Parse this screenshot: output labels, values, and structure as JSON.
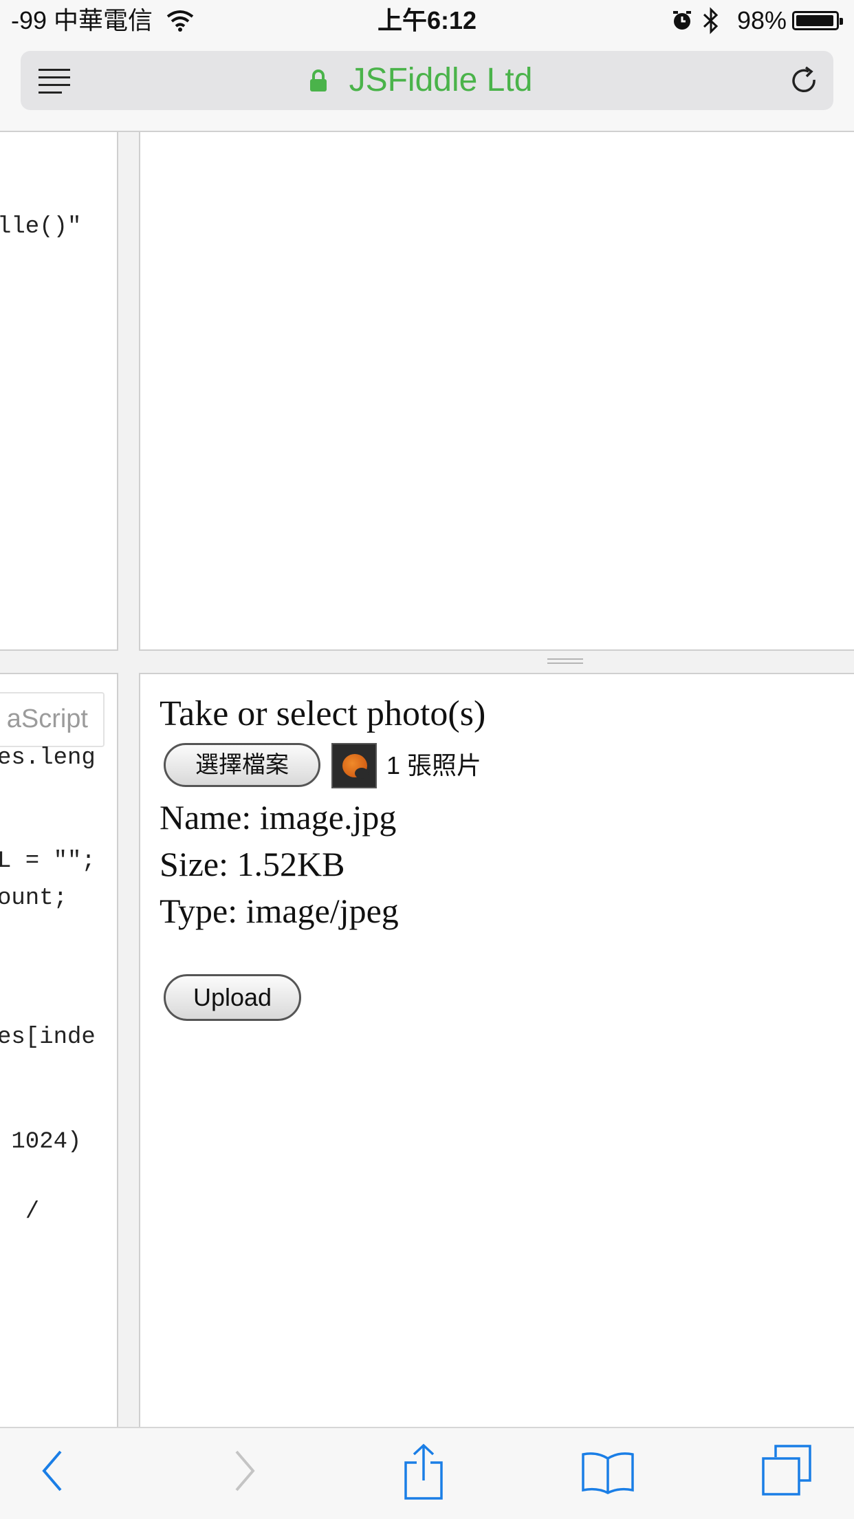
{
  "status_bar": {
    "carrier": "-99 中華電信",
    "time": "上午6:12",
    "battery": "98%"
  },
  "address_bar": {
    "site_name": "JSFiddle Ltd"
  },
  "code_fragments": {
    "html_line": "lle()\"",
    "lang_label": "aScript",
    "js_lines": [
      "es.leng",
      "L = \"\";",
      "ount;",
      "es[inde",
      " 1024)",
      "  /"
    ]
  },
  "result": {
    "heading": "Take or select photo(s)",
    "choose_file_label": "選擇檔案",
    "photo_count": "1 張照片",
    "name_line": "Name: image.jpg",
    "size_line": "Size: 1.52KB",
    "type_line": "Type: image/jpeg",
    "upload_label": "Upload"
  },
  "toolbar": {
    "icons": [
      "back-icon",
      "forward-icon",
      "share-icon",
      "bookmarks-icon",
      "tabs-icon"
    ]
  },
  "colors": {
    "url_green": "#4ab34a",
    "toolbar_blue": "#1a7ee6"
  }
}
